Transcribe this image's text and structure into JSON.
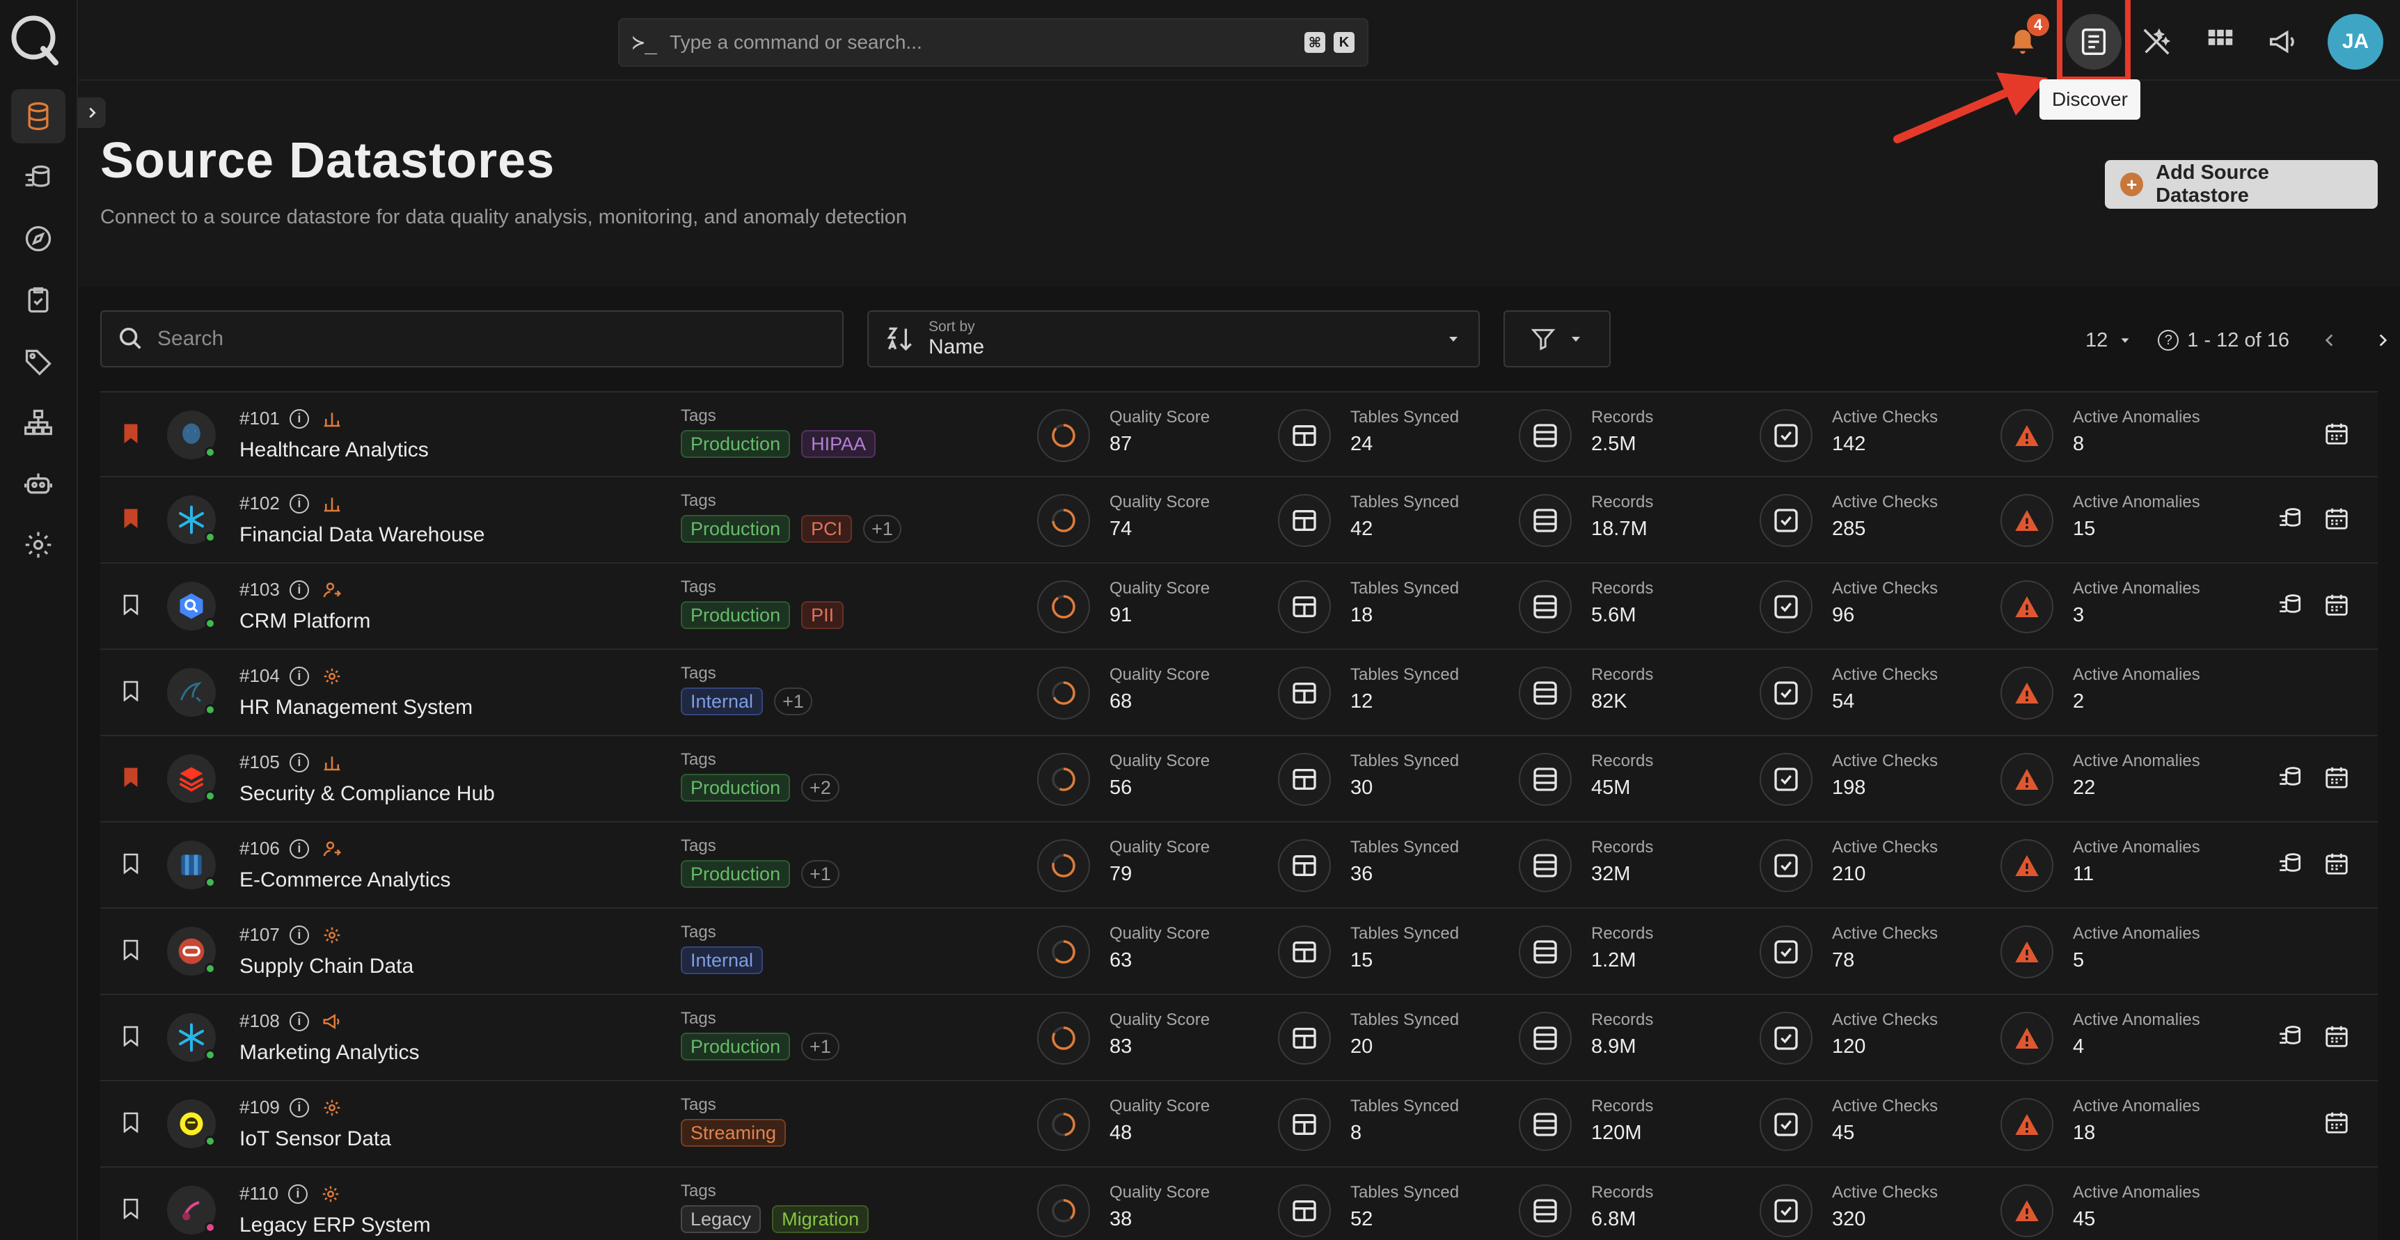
{
  "topbar": {
    "search_placeholder": "Type a command or search...",
    "prompt_glyph": "≻_",
    "shortcut_keys": [
      "⌘",
      "K"
    ],
    "notifications_count": "4",
    "tooltip": "Discover",
    "avatar_initials": "JA"
  },
  "header": {
    "title": "Source Datastores",
    "subtitle": "Connect to a source datastore for data quality analysis, monitoring, and anomaly detection",
    "add_button": "Add Source Datastore"
  },
  "filters": {
    "search_placeholder": "Search",
    "sort_label": "Sort by",
    "sort_value": "Name",
    "page_size": "12",
    "range": "1 - 12 of 16"
  },
  "metric_labels": {
    "quality": "Quality Score",
    "tables": "Tables Synced",
    "records": "Records",
    "checks": "Active Checks",
    "anomalies": "Active Anomalies"
  },
  "tags_label": "Tags",
  "colors": {
    "accent": "#e07b39",
    "success": "#3fb950",
    "highlight": "#e53a2a"
  },
  "rows": [
    {
      "id": "#101",
      "name": "Healthcare Analytics",
      "bookmarked": true,
      "type_icon": "chart-icon",
      "logo": "postgres-icon",
      "tags": [
        {
          "label": "Production",
          "kind": "prod"
        },
        {
          "label": "HIPAA",
          "kind": "hipaa"
        }
      ],
      "quality": "87",
      "tables": "24",
      "records": "2.5M",
      "checks": "142",
      "anomalies": "8",
      "actions": [
        "calendar"
      ]
    },
    {
      "id": "#102",
      "name": "Financial Data Warehouse",
      "bookmarked": true,
      "type_icon": "chart-icon",
      "logo": "snowflake-icon",
      "tags": [
        {
          "label": "Production",
          "kind": "prod"
        },
        {
          "label": "PCI",
          "kind": "red"
        },
        {
          "label": "+1",
          "kind": "more"
        }
      ],
      "quality": "74",
      "tables": "42",
      "records": "18.7M",
      "checks": "285",
      "anomalies": "15",
      "actions": [
        "enrich",
        "calendar"
      ]
    },
    {
      "id": "#103",
      "name": "CRM Platform",
      "bookmarked": false,
      "type_icon": "user-link-icon",
      "logo": "bigquery-icon",
      "tags": [
        {
          "label": "Production",
          "kind": "prod"
        },
        {
          "label": "PII",
          "kind": "red"
        }
      ],
      "quality": "91",
      "tables": "18",
      "records": "5.6M",
      "checks": "96",
      "anomalies": "3",
      "actions": [
        "enrich",
        "calendar"
      ]
    },
    {
      "id": "#104",
      "name": "HR Management System",
      "bookmarked": false,
      "type_icon": "gear-icon",
      "logo": "mysql-icon",
      "tags": [
        {
          "label": "Internal",
          "kind": "internal"
        },
        {
          "label": "+1",
          "kind": "more"
        }
      ],
      "quality": "68",
      "tables": "12",
      "records": "82K",
      "checks": "54",
      "anomalies": "2",
      "actions": []
    },
    {
      "id": "#105",
      "name": "Security & Compliance Hub",
      "bookmarked": true,
      "type_icon": "chart-icon",
      "logo": "databricks-icon",
      "tags": [
        {
          "label": "Production",
          "kind": "prod"
        },
        {
          "label": "+2",
          "kind": "more"
        }
      ],
      "quality": "56",
      "tables": "30",
      "records": "45M",
      "checks": "198",
      "anomalies": "22",
      "actions": [
        "enrich",
        "calendar"
      ]
    },
    {
      "id": "#106",
      "name": "E-Commerce Analytics",
      "bookmarked": false,
      "type_icon": "user-link-icon",
      "logo": "redshift-icon",
      "tags": [
        {
          "label": "Production",
          "kind": "prod"
        },
        {
          "label": "+1",
          "kind": "more"
        }
      ],
      "quality": "79",
      "tables": "36",
      "records": "32M",
      "checks": "210",
      "anomalies": "11",
      "actions": [
        "enrich",
        "calendar"
      ]
    },
    {
      "id": "#107",
      "name": "Supply Chain Data",
      "bookmarked": false,
      "type_icon": "gear-icon",
      "logo": "oracle-icon",
      "tags": [
        {
          "label": "Internal",
          "kind": "internal"
        }
      ],
      "quality": "63",
      "tables": "15",
      "records": "1.2M",
      "checks": "78",
      "anomalies": "5",
      "actions": []
    },
    {
      "id": "#108",
      "name": "Marketing Analytics",
      "bookmarked": false,
      "type_icon": "megaphone-icon",
      "logo": "snowflake-icon",
      "tags": [
        {
          "label": "Production",
          "kind": "prod"
        },
        {
          "label": "+1",
          "kind": "more"
        }
      ],
      "quality": "83",
      "tables": "20",
      "records": "8.9M",
      "checks": "120",
      "anomalies": "4",
      "actions": [
        "enrich",
        "calendar"
      ]
    },
    {
      "id": "#109",
      "name": "IoT Sensor Data",
      "bookmarked": false,
      "type_icon": "gear-icon",
      "logo": "hive-icon",
      "tags": [
        {
          "label": "Streaming",
          "kind": "stream"
        }
      ],
      "quality": "48",
      "tables": "8",
      "records": "120M",
      "checks": "45",
      "anomalies": "18",
      "actions": [
        "calendar"
      ]
    },
    {
      "id": "#110",
      "name": "Legacy ERP System",
      "bookmarked": false,
      "type_icon": "gear-icon",
      "logo": "db2-icon",
      "tags": [
        {
          "label": "Legacy",
          "kind": "legacy"
        },
        {
          "label": "Migration",
          "kind": "mig"
        }
      ],
      "quality": "38",
      "tables": "52",
      "records": "6.8M",
      "checks": "320",
      "anomalies": "45",
      "actions": [],
      "status": "pink"
    }
  ]
}
